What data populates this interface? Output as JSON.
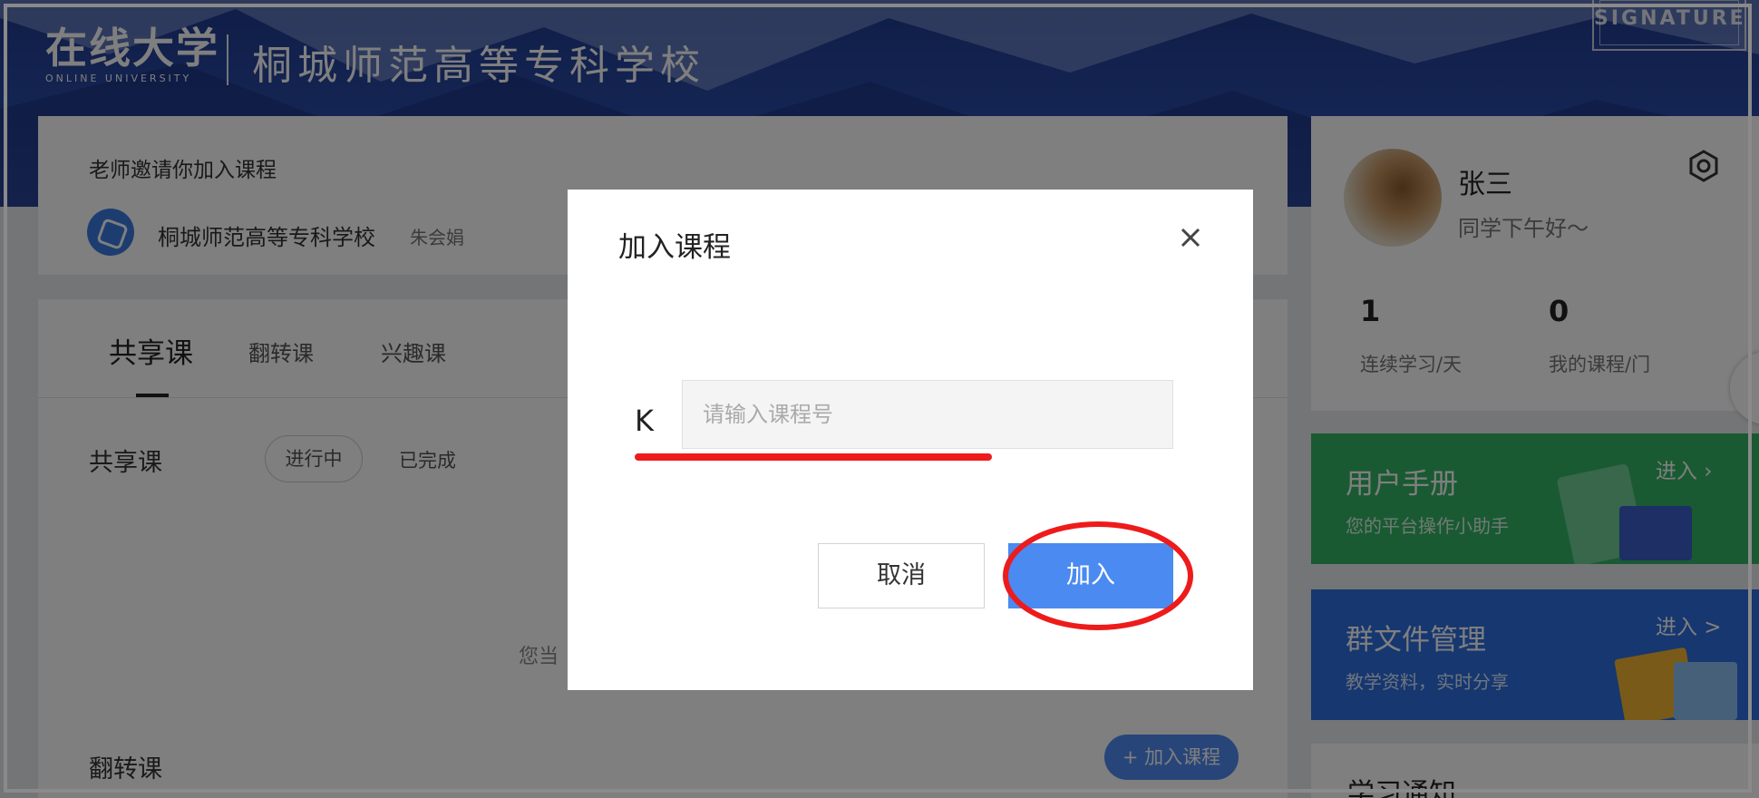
{
  "header": {
    "logo_main": "在线大学",
    "logo_sub": "ONLINE UNIVERSITY",
    "school_name": "桐城师范高等专科学校",
    "signature_text": "SIGNATURE"
  },
  "invite": {
    "title": "老师邀请你加入课程",
    "school": "桐城师范高等专科学校",
    "teacher": "朱会娟"
  },
  "courses": {
    "tabs": [
      {
        "label": "共享课",
        "active": true
      },
      {
        "label": "翻转课",
        "active": false
      },
      {
        "label": "兴趣课",
        "active": false
      }
    ],
    "section_shared": "共享课",
    "filter_active": "进行中",
    "filter_done": "已完成",
    "empty_text": "您当",
    "section_flip": "翻转课",
    "add_course_label": "加入课程"
  },
  "profile": {
    "name": "张三",
    "greeting": "同学下午好～",
    "stats": [
      {
        "value": "1",
        "label": "连续学习/天"
      },
      {
        "value": "0",
        "label": "我的课程/门"
      }
    ]
  },
  "cards": {
    "manual_title": "用户手册",
    "manual_sub": "您的平台操作小助手",
    "manual_enter": "进入",
    "files_title": "群文件管理",
    "files_sub": "教学资料，实时分享",
    "files_enter": "进入 >"
  },
  "notice": {
    "title": "学习通知"
  },
  "dialog": {
    "title": "加入课程",
    "input_value": "K",
    "input_placeholder": "请输入课程号",
    "cancel_label": "取消",
    "join_label": "加入"
  },
  "colors": {
    "banner": "#2a4aa6",
    "green_card": "#32b565",
    "blue_card": "#2c6fe0",
    "primary_button": "#4a8af1",
    "annotation_red": "#ee1b1b"
  }
}
